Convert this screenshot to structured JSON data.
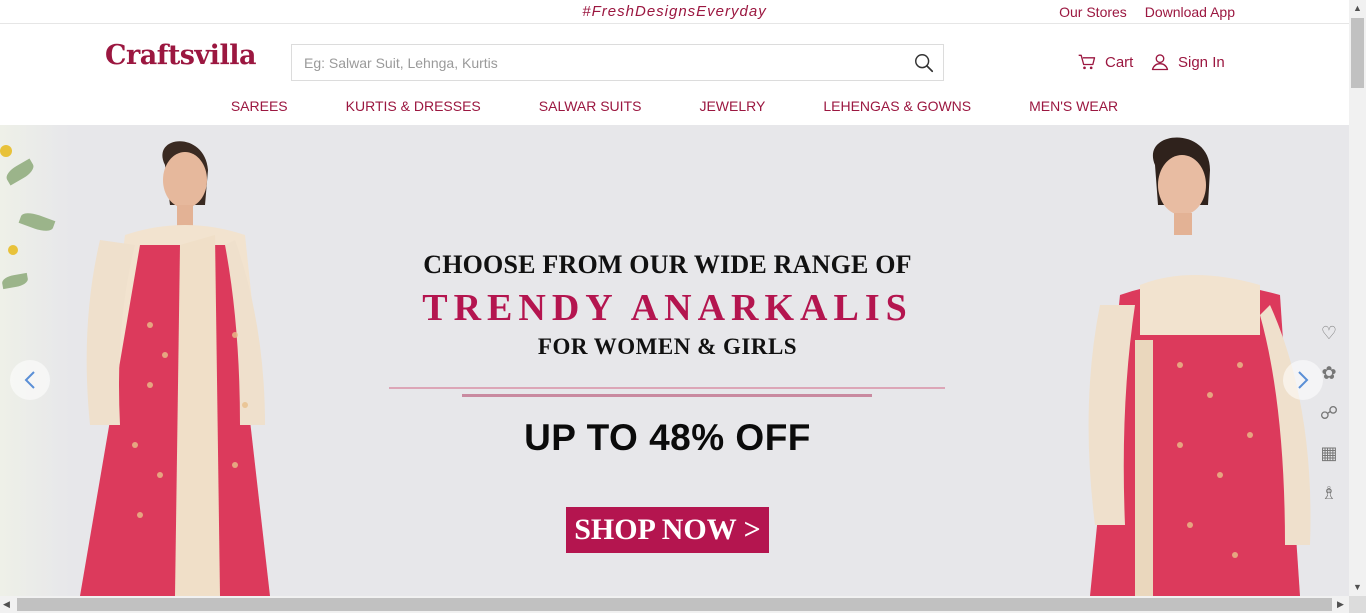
{
  "topbar": {
    "tagline": "#FreshDesignsEveryday",
    "links": [
      "Our Stores",
      "Download App"
    ]
  },
  "header": {
    "logo": "Craftsvilla",
    "search_placeholder": "Eg: Salwar Suit, Lehnga, Kurtis",
    "cart_label": "Cart",
    "signin_label": "Sign In"
  },
  "nav": {
    "items": [
      "SAREES",
      "KURTIS & DRESSES",
      "SALWAR SUITS",
      "JEWELRY",
      "LEHENGAS & GOWNS",
      "MEN'S WEAR"
    ]
  },
  "banner": {
    "line1": "CHOOSE FROM OUR WIDE RANGE OF",
    "line2": "TRENDY ANARKALIS",
    "line3": "FOR WOMEN & GIRLS",
    "offer": "UP TO 48% OFF",
    "cta": "SHOP NOW >"
  },
  "colors": {
    "brand": "#9b1740",
    "accent": "#b4154f",
    "banner_bg": "#e7e7ea"
  },
  "icons": [
    "search-icon",
    "cart-icon",
    "user-icon",
    "chevron-left-icon",
    "chevron-right-icon",
    "heart-icon",
    "gift-icon",
    "qr-icon",
    "hanger-icon"
  ]
}
